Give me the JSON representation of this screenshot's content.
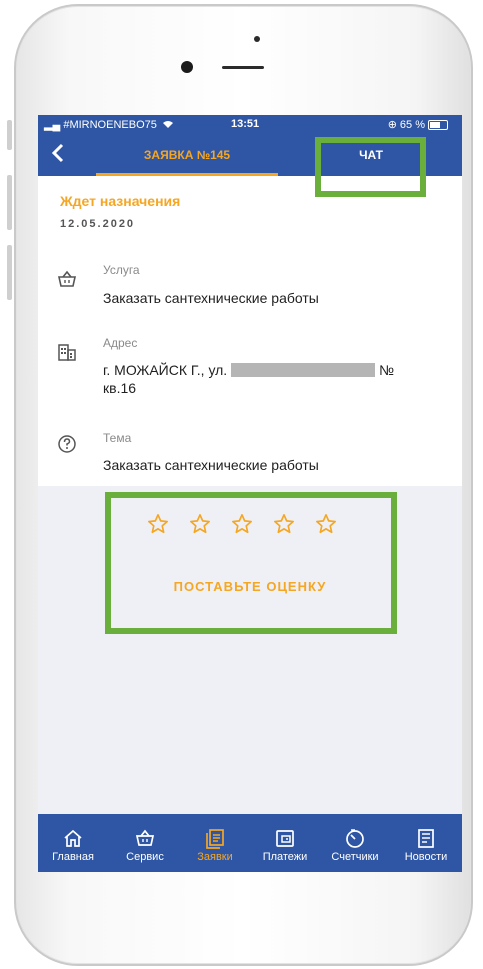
{
  "status_bar": {
    "carrier": "#MIRNOENEBO75",
    "time": "13:51",
    "battery": "65 %"
  },
  "header": {
    "back_icon": "chevron-left-icon",
    "tab_request": "ЗАЯВКА №145",
    "tab_chat": "ЧАТ"
  },
  "request": {
    "status": "Ждет назначения",
    "date": "12.05.2020",
    "service": {
      "label": "Услуга",
      "value": "Заказать сантехнические работы",
      "icon": "basket-icon"
    },
    "address": {
      "label": "Адрес",
      "value_prefix": "г. МОЖАЙСК Г., ул.",
      "value_suffix": "№",
      "value_line2": "кв.16",
      "icon": "building-icon"
    },
    "topic": {
      "label": "Тема",
      "value": "Заказать сантехнические работы",
      "icon": "question-icon"
    }
  },
  "rating": {
    "stars": 5,
    "selected": 0,
    "action": "ПОСТАВЬТЕ ОЦЕНКУ"
  },
  "tabbar": {
    "items": [
      {
        "label": "Главная",
        "icon": "home-icon"
      },
      {
        "label": "Сервис",
        "icon": "basket-icon"
      },
      {
        "label": "Заявки",
        "icon": "requests-icon"
      },
      {
        "label": "Платежи",
        "icon": "wallet-icon"
      },
      {
        "label": "Счетчики",
        "icon": "meter-icon"
      },
      {
        "label": "Новости",
        "icon": "news-icon"
      }
    ],
    "active": "Заявки"
  },
  "colors": {
    "brand": "#2f56a4",
    "accent": "#f5a623",
    "highlight": "#6aae3c"
  }
}
